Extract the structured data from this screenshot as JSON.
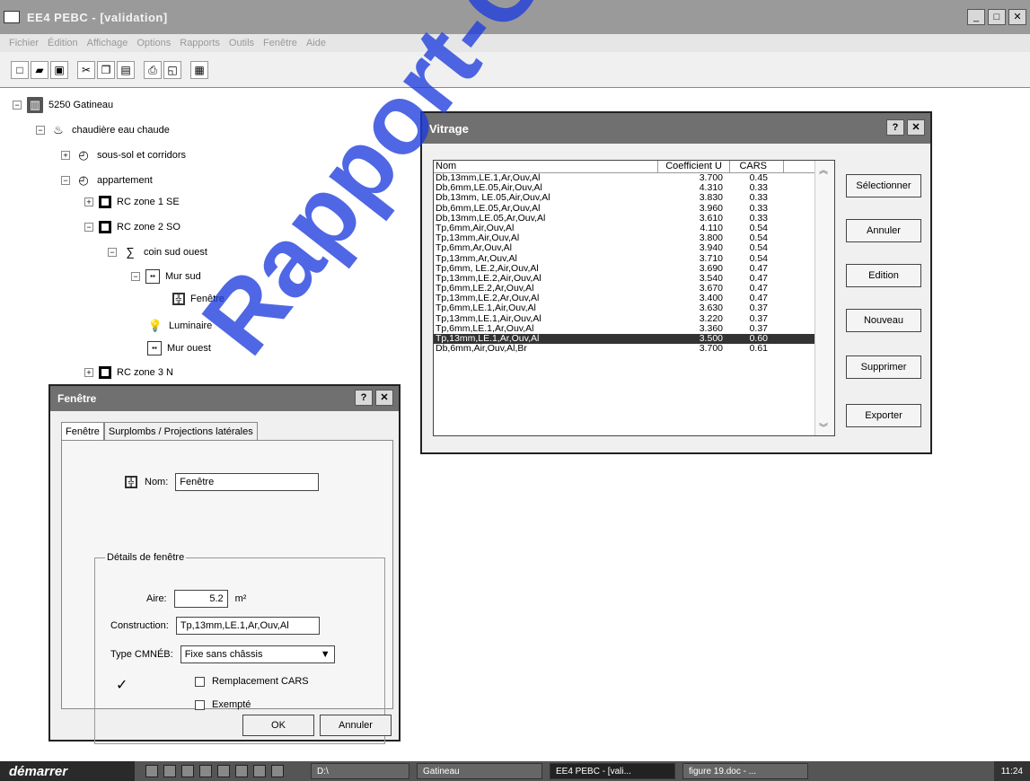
{
  "window": {
    "title": "EE4 PEBC - [validation]",
    "min": "_",
    "max": "□",
    "close": "✕"
  },
  "menu": [
    "Fichier",
    "Édition",
    "Affichage",
    "Options",
    "Rapports",
    "Outils",
    "Fenêtre",
    "Aide"
  ],
  "toolbar": [
    "new-icon",
    "open-icon",
    "save-icon",
    "cut-icon",
    "copy-icon",
    "paste-icon",
    "print-icon",
    "preview-icon",
    "calculator-icon"
  ],
  "tree": {
    "root": "5250 Gatineau",
    "system": "chaudière eau chaude",
    "sous_sol": "sous-sol et corridors",
    "appartement": "appartement",
    "zone1": "RC zone 1 SE",
    "zone2": "RC zone 2 SO",
    "coin": "coin sud ouest",
    "mur_sud": "Mur sud",
    "fenetre": "Fenêtre",
    "luminaire": "Luminaire",
    "mur_ouest": "Mur ouest",
    "zone3": "RC zone 3 N"
  },
  "vitrage": {
    "title": "Vitrage",
    "col_nom": "Nom",
    "col_u": "Coefficient U",
    "col_cars": "CARS",
    "rows": [
      {
        "nom": "Db,13mm,LE.1,Ar,Ouv,Al",
        "u": "3.700",
        "cars": "0.45"
      },
      {
        "nom": "Db,6mm,LE.05,Air,Ouv,Al",
        "u": "4.310",
        "cars": "0.33"
      },
      {
        "nom": "Db,13mm, LE.05,Air,Ouv,Al",
        "u": "3.830",
        "cars": "0.33"
      },
      {
        "nom": "Db,6mm,LE.05,Ar,Ouv,Al",
        "u": "3.960",
        "cars": "0.33"
      },
      {
        "nom": "Db,13mm,LE.05,Ar,Ouv,Al",
        "u": "3.610",
        "cars": "0.33"
      },
      {
        "nom": "Tp,6mm,Air,Ouv,Al",
        "u": "4.110",
        "cars": "0.54"
      },
      {
        "nom": "Tp,13mm,Air,Ouv,Al",
        "u": "3.800",
        "cars": "0.54"
      },
      {
        "nom": "Tp,6mm,Ar,Ouv,Al",
        "u": "3.940",
        "cars": "0.54"
      },
      {
        "nom": "Tp,13mm,Ar,Ouv,Al",
        "u": "3.710",
        "cars": "0.54"
      },
      {
        "nom": "Tp,6mm, LE.2,Air,Ouv,Al",
        "u": "3.690",
        "cars": "0.47"
      },
      {
        "nom": "Tp,13mm,LE.2,Air,Ouv,Al",
        "u": "3.540",
        "cars": "0.47"
      },
      {
        "nom": "Tp,6mm,LE.2,Ar,Ouv,Al",
        "u": "3.670",
        "cars": "0.47"
      },
      {
        "nom": "Tp,13mm,LE.2,Ar,Ouv,Al",
        "u": "3.400",
        "cars": "0.47"
      },
      {
        "nom": "Tp,6mm,LE.1,Air,Ouv,Al",
        "u": "3.630",
        "cars": "0.37"
      },
      {
        "nom": "Tp,13mm,LE.1,Air,Ouv,Al",
        "u": "3.220",
        "cars": "0.37"
      },
      {
        "nom": "Tp,6mm,LE.1,Ar,Ouv,Al",
        "u": "3.360",
        "cars": "0.37"
      },
      {
        "nom": "Tp,13mm,LE.1,Ar,Ouv,Al",
        "u": "3.500",
        "cars": "0.60"
      },
      {
        "nom": "Db,6mm,Air,Ouv,Al,Br",
        "u": "3.700",
        "cars": "0.61"
      }
    ],
    "buttons": {
      "select": "Sélectionner",
      "cancel": "Annuler",
      "edit": "Edition",
      "new": "Nouveau",
      "delete": "Supprimer",
      "export": "Exporter"
    }
  },
  "fenetre": {
    "title": "Fenêtre",
    "tab1": "Fenêtre",
    "tab2": "Surplombs / Projections latérales",
    "nom_label": "Nom:",
    "nom_value": "Fenêtre",
    "details_label": "Détails de fenêtre",
    "aire_label": "Aire:",
    "aire_value": "5.2",
    "aire_unit": "m²",
    "construction_label": "Construction:",
    "construction_value": "Tp,13mm,LE.1,Ar,Ouv,Al",
    "type_label": "Type CMNÉB:",
    "type_value": "Fixe sans châssis",
    "check1": "Remplacement CARS",
    "check2": "Exempté",
    "ok": "OK",
    "cancel": "Annuler"
  },
  "taskbar": {
    "start": "démarrer",
    "tasks": [
      "D:\\",
      "Gatineau",
      "EE4 PEBC - [vali...",
      "figure 19.doc - ..."
    ],
    "clock": "11:24"
  },
  "watermark": "Rapport-Gratuit.com"
}
